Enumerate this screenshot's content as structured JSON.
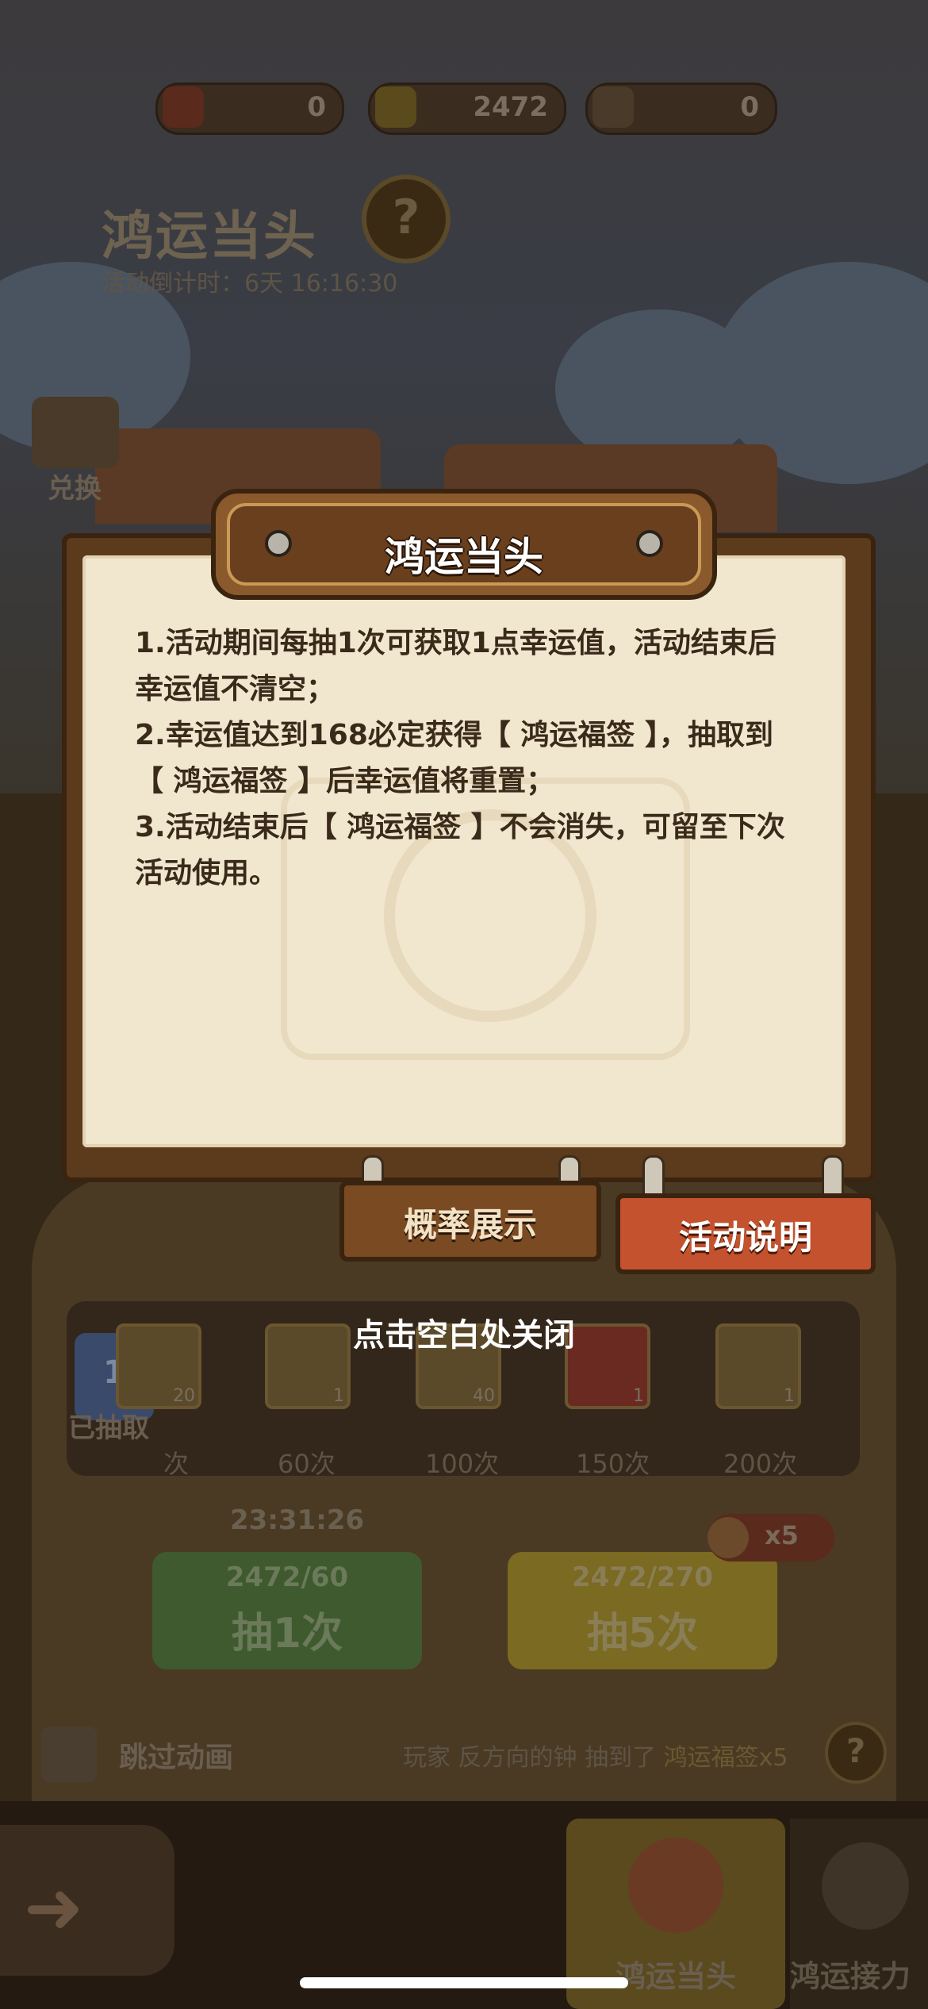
{
  "resources": [
    {
      "name": "ticket",
      "value": "0",
      "icon": "red-ticket-icon"
    },
    {
      "name": "gold-ingot",
      "value": "2472",
      "icon": "gold-ingot-icon"
    },
    {
      "name": "fan",
      "value": "0",
      "icon": "fan-icon"
    }
  ],
  "background": {
    "title": "鸿运当头",
    "countdown": "活动倒计时：6天 16:16:30",
    "exchange_label": "兑换",
    "drawn_count": "1",
    "drawn_label": "已抽取",
    "reward_counts": [
      "20",
      "1",
      "40",
      "1",
      "1"
    ],
    "milestones": [
      "次",
      "60次",
      "100次",
      "150次",
      "200次"
    ],
    "free_timer": "23:31:26",
    "draw1": {
      "cost": "2472/60",
      "label": "抽1次"
    },
    "draw5": {
      "cost": "2472/270",
      "label": "抽5次"
    },
    "refresh_multiplier": "x5",
    "skip_animation": "跳过动画",
    "broadcast": {
      "prefix": "玩家",
      "player": "反方向的钟",
      "verb": "抽到了",
      "item": "鸿运福签x5"
    },
    "bottom_tabs": [
      "鸿运当头",
      "鸿运接力"
    ]
  },
  "modal": {
    "title": "鸿运当头",
    "rules": [
      "1.活动期间每抽1次可获取1点幸运值，活动结束后幸运值不清空；",
      "2.幸运值达到168必定获得【 鸿运福签 】，抽取到【 鸿运福签 】后幸运值将重置；",
      "3.活动结束后【 鸿运福签 】不会消失，可留至下次活动使用。"
    ],
    "tab_probability": "概率展示",
    "tab_rules": "活动说明",
    "close_hint": "点击空白处关闭"
  },
  "colors": {
    "paper": "#f1e7cf",
    "board": "#5c3a1c",
    "active_tab": "#c4522e",
    "inactive_tab": "#7a4a22",
    "green_button": "#3f5a2e",
    "yellow_button": "#7a6a22"
  }
}
